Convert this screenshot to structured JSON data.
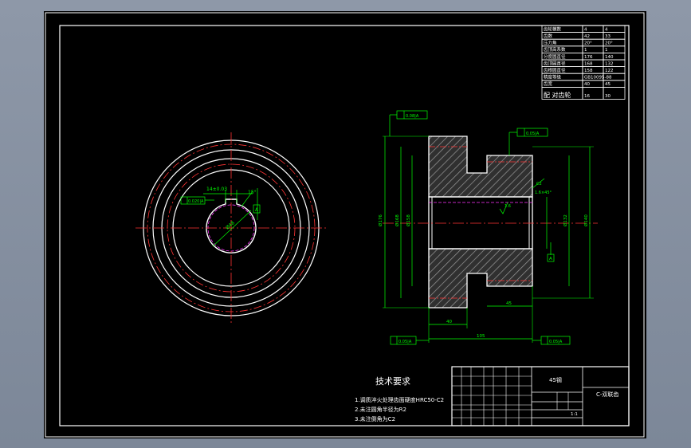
{
  "colors": {
    "background": "#8e98a8",
    "sheet": "#000000",
    "outline": "#ffffff",
    "dimension": "#00ff00",
    "centerline": "#ff3333",
    "hidden": "#ff33ff",
    "hatch": "#808080"
  },
  "param_table": {
    "rows": [
      {
        "label": "齿轮模数",
        "a": "4",
        "b": "4"
      },
      {
        "label": "齿数",
        "a": "42",
        "b": "33"
      },
      {
        "label": "压力角",
        "a": "20°",
        "b": "20°"
      },
      {
        "label": "齿顶高系数",
        "a": "1",
        "b": "1"
      },
      {
        "label": "分度圆直径",
        "a": "176",
        "b": "140"
      },
      {
        "label": "齿顶圆直径",
        "a": "168",
        "b": "132"
      },
      {
        "label": "齿根圆直径",
        "a": "158",
        "b": "122"
      },
      {
        "label": "精度等级",
        "a": "GB10095-88",
        "b": ""
      },
      {
        "label": "齿宽",
        "a": "40",
        "b": "45"
      },
      {
        "label": "配 对齿轮",
        "a": "16",
        "b": "30"
      }
    ]
  },
  "tech_req": {
    "title": "技术要求",
    "items": [
      "1.调质淬火处理齿面硬度HRC50-C2",
      "2.未注圆角半径为R2",
      "3.未注倒角为C2"
    ]
  },
  "title_block": {
    "material": "45钢",
    "part_name": "C-双联齿",
    "scale": "1:1"
  },
  "dims": {
    "front": {
      "keyway": "14±0.03",
      "angle": "15°",
      "datum": "A",
      "ref": "0.020|A",
      "bore": "Ø48"
    },
    "section": {
      "top_left_tol": "0.08|A",
      "top_right_tol": "0.05|A",
      "bottom_left_tol": "0.05|A",
      "bottom_right_tol": "0.05|A",
      "width_left": "40",
      "width_right": "45",
      "total_width": "105",
      "chamfer": "C2",
      "chamfer_angle": "1.6×45°",
      "roughness": "1.6",
      "datum": "A",
      "dia_left_outer": "Ø176",
      "dia_left_inner": "Ø168",
      "dia_left_root": "Ø158",
      "dia_right_outer": "Ø140",
      "dia_right_inner": "Ø132"
    }
  }
}
